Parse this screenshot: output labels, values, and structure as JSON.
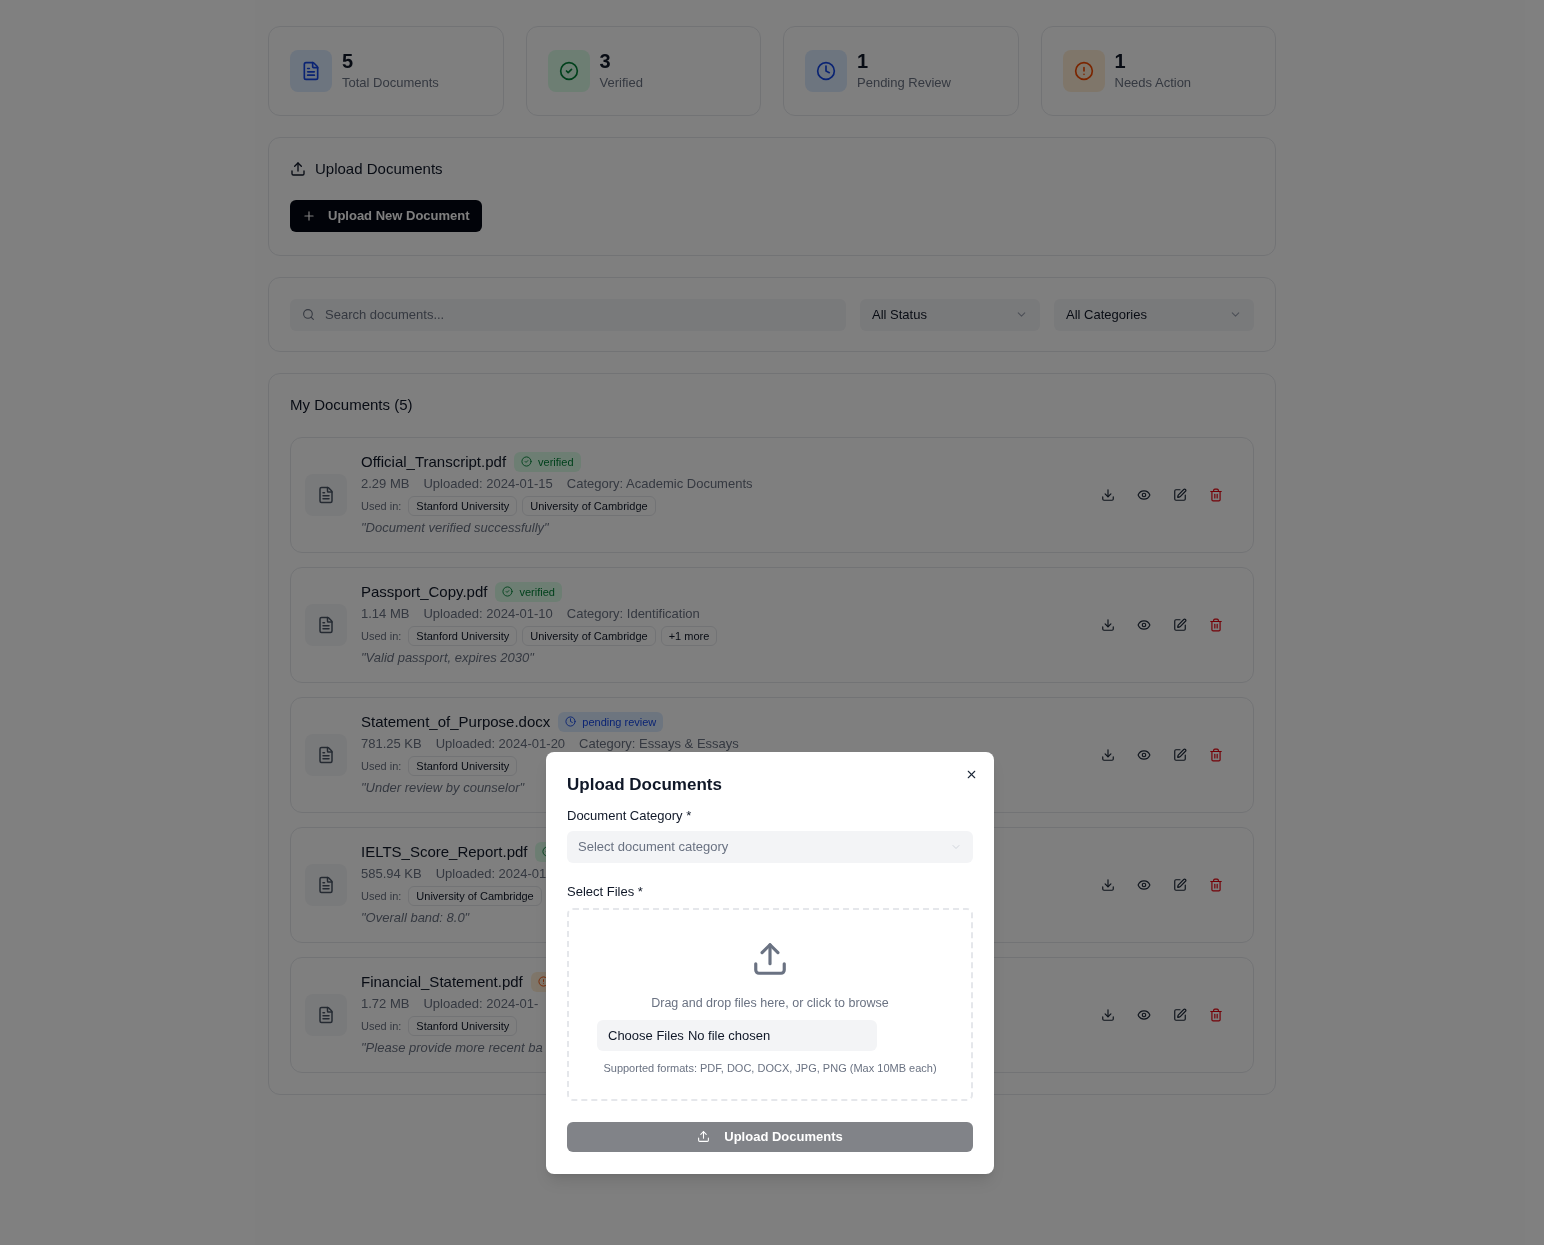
{
  "stats": [
    {
      "kind": "total",
      "value": "5",
      "label": "Total Documents"
    },
    {
      "kind": "verified",
      "value": "3",
      "label": "Verified"
    },
    {
      "kind": "pending",
      "value": "1",
      "label": "Pending Review"
    },
    {
      "kind": "action",
      "value": "1",
      "label": "Needs Action"
    }
  ],
  "upload_section": {
    "title": "Upload Documents",
    "button": "Upload New Document"
  },
  "filters": {
    "search_placeholder": "Search documents...",
    "status": "All Status",
    "category": "All Categories"
  },
  "documents_title": "My Documents (5)",
  "documents": [
    {
      "name": "Official_Transcript.pdf",
      "kind": "verified",
      "status_label": "verified",
      "size": "2.29 MB",
      "uploaded": "Uploaded: 2024-01-15",
      "category": "Category: Academic Documents",
      "used_in_label": "Used in:",
      "used_in": [
        "Stanford University",
        "University of Cambridge"
      ],
      "note": "\"Document verified successfully\""
    },
    {
      "name": "Passport_Copy.pdf",
      "kind": "verified",
      "status_label": "verified",
      "size": "1.14 MB",
      "uploaded": "Uploaded: 2024-01-10",
      "category": "Category: Identification",
      "used_in_label": "Used in:",
      "used_in": [
        "Stanford University",
        "University of Cambridge"
      ],
      "more": "+1 more",
      "note": "\"Valid passport, expires 2030\""
    },
    {
      "name": "Statement_of_Purpose.docx",
      "kind": "pending",
      "status_label": "pending review",
      "size": "781.25 KB",
      "uploaded": "Uploaded: 2024-01-20",
      "category": "Category: Essays & Essays",
      "used_in_label": "Used in:",
      "used_in": [
        "Stanford University"
      ],
      "note": "\"Under review by counselor\""
    },
    {
      "name": "IELTS_Score_Report.pdf",
      "kind": "verified",
      "size": "585.94 KB",
      "uploaded": "Uploaded: 2024-01",
      "used_in_label": "Used in:",
      "used_in": [
        "University of Cambridge"
      ],
      "note": "\"Overall band: 8.0\""
    },
    {
      "name": "Financial_Statement.pdf",
      "kind": "action",
      "size": "1.72 MB",
      "uploaded": "Uploaded: 2024-01-",
      "used_in_label": "Used in:",
      "used_in": [
        "Stanford University"
      ],
      "note": "\"Please provide more recent ba"
    }
  ],
  "modal": {
    "title": "Upload Documents",
    "category_label": "Document Category *",
    "category_placeholder": "Select document category",
    "files_label": "Select Files *",
    "drop_text": "Drag and drop files here, or click to browse",
    "choose_button": "Choose Files",
    "no_file": "No file chosen",
    "formats": "Supported formats: PDF, DOC, DOCX, JPG, PNG (Max 10MB each)",
    "submit": "Upload Documents",
    "submit_disabled": true
  }
}
